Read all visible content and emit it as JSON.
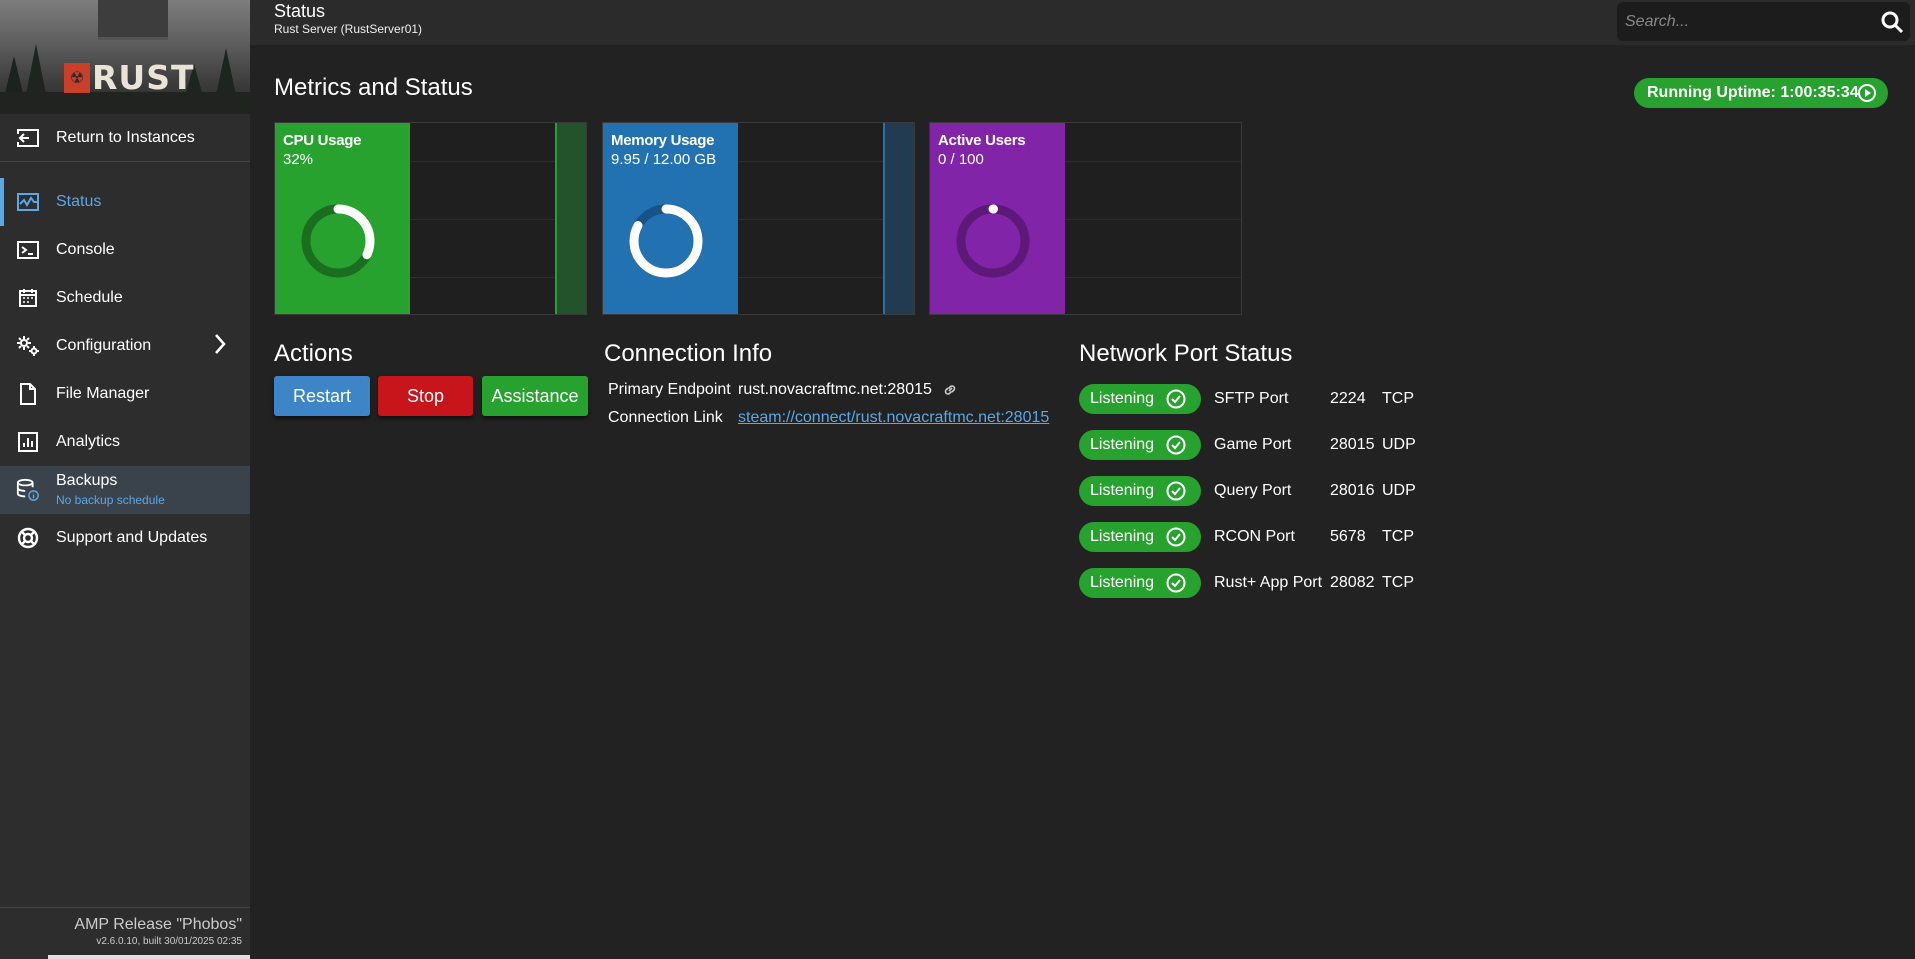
{
  "brand": {
    "logo_text": "RUST"
  },
  "sidebar": {
    "return_label": "Return to Instances",
    "items": [
      {
        "label": "Status",
        "icon": "status-chart-icon"
      },
      {
        "label": "Console",
        "icon": "console-icon"
      },
      {
        "label": "Schedule",
        "icon": "calendar-icon"
      },
      {
        "label": "Configuration",
        "icon": "gears-icon"
      },
      {
        "label": "File Manager",
        "icon": "file-icon"
      },
      {
        "label": "Analytics",
        "icon": "analytics-icon"
      },
      {
        "label": "Backups",
        "icon": "database-icon",
        "sub": "No backup schedule"
      },
      {
        "label": "Support and Updates",
        "icon": "lifebuoy-icon"
      }
    ],
    "release": "AMP Release \"Phobos\"",
    "build": "v2.6.0.10, built 30/01/2025 02:35"
  },
  "header": {
    "title": "Status",
    "subtitle": "Rust Server (RustServer01)",
    "search_placeholder": "Search..."
  },
  "metrics": {
    "title": "Metrics and Status",
    "uptime": "Running Uptime: 1:00:35:34",
    "cards": [
      {
        "title": "CPU Usage",
        "value": "32%",
        "fraction": 0.32,
        "color": "#27a22e"
      },
      {
        "title": "Memory Usage",
        "value": "9.95 / 12.00 GB",
        "fraction": 0.829,
        "color": "#2271b0"
      },
      {
        "title": "Active Users",
        "value": "0 / 100",
        "fraction": 0.0,
        "color": "#8224a8"
      }
    ]
  },
  "actions": {
    "title": "Actions",
    "restart": "Restart",
    "stop": "Stop",
    "assistance": "Assistance"
  },
  "connection": {
    "title": "Connection Info",
    "endpoint_label": "Primary Endpoint",
    "endpoint_value": "rust.novacraftmc.net:28015",
    "link_label": "Connection Link",
    "link_value": "steam://connect/rust.novacraftmc.net:28015"
  },
  "ports": {
    "title": "Network Port Status",
    "rows": [
      {
        "status": "Listening",
        "name": "SFTP Port",
        "port": "2224",
        "proto": "TCP"
      },
      {
        "status": "Listening",
        "name": "Game Port",
        "port": "28015",
        "proto": "UDP"
      },
      {
        "status": "Listening",
        "name": "Query Port",
        "port": "28016",
        "proto": "UDP"
      },
      {
        "status": "Listening",
        "name": "RCON Port",
        "port": "5678",
        "proto": "TCP"
      },
      {
        "status": "Listening",
        "name": "Rust+ App Port",
        "port": "28082",
        "proto": "TCP"
      }
    ]
  }
}
